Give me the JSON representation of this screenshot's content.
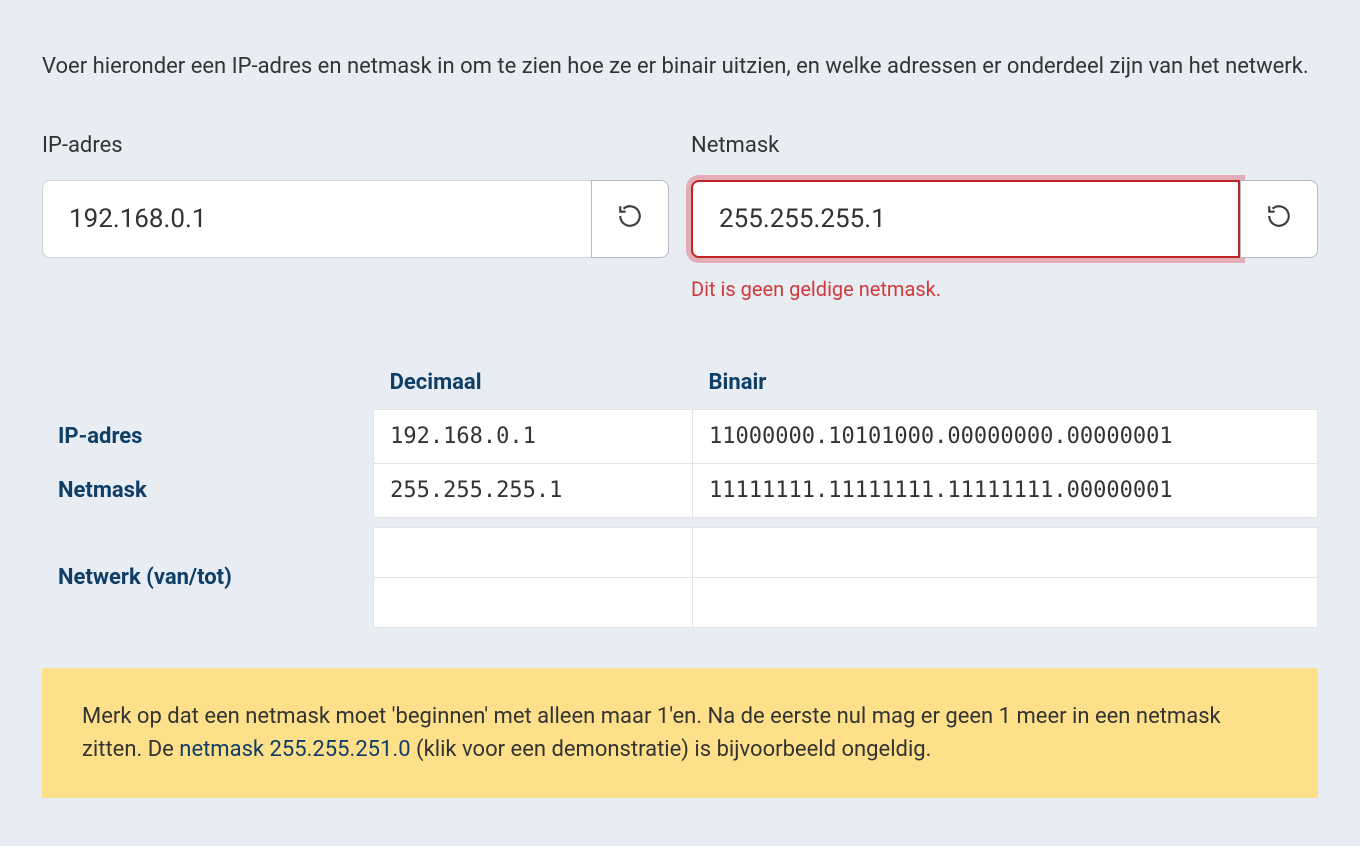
{
  "intro": "Voer hieronder een IP-adres en netmask in om te zien hoe ze er binair uitzien, en welke adressen er onderdeel zijn van het netwerk.",
  "ip": {
    "label": "IP-adres",
    "value": "192.168.0.1"
  },
  "netmask": {
    "label": "Netmask",
    "value": "255.255.255.1",
    "error": "Dit is geen geldige netmask."
  },
  "table": {
    "headers": {
      "decimal": "Decimaal",
      "binary": "Binair"
    },
    "rows": {
      "ip": {
        "label": "IP-adres",
        "decimal": "192.168.0.1",
        "binary": "11000000.10101000.00000000.00000001"
      },
      "netmask": {
        "label": "Netmask",
        "decimal": "255.255.255.1",
        "binary": "11111111.11111111.11111111.00000001"
      },
      "range": {
        "label": "Netwerk (van/tot)",
        "from_decimal": "",
        "from_binary": "",
        "to_decimal": "",
        "to_binary": ""
      }
    }
  },
  "note": {
    "pre": "Merk op dat een netmask moet 'beginnen' met alleen maar 1'en. Na de eerste nul mag er geen 1 meer in een netmask zitten. De ",
    "link": "netmask 255.255.251.0",
    "post": " (klik voor een demonstratie) is bijvoorbeeld ongeldig."
  }
}
